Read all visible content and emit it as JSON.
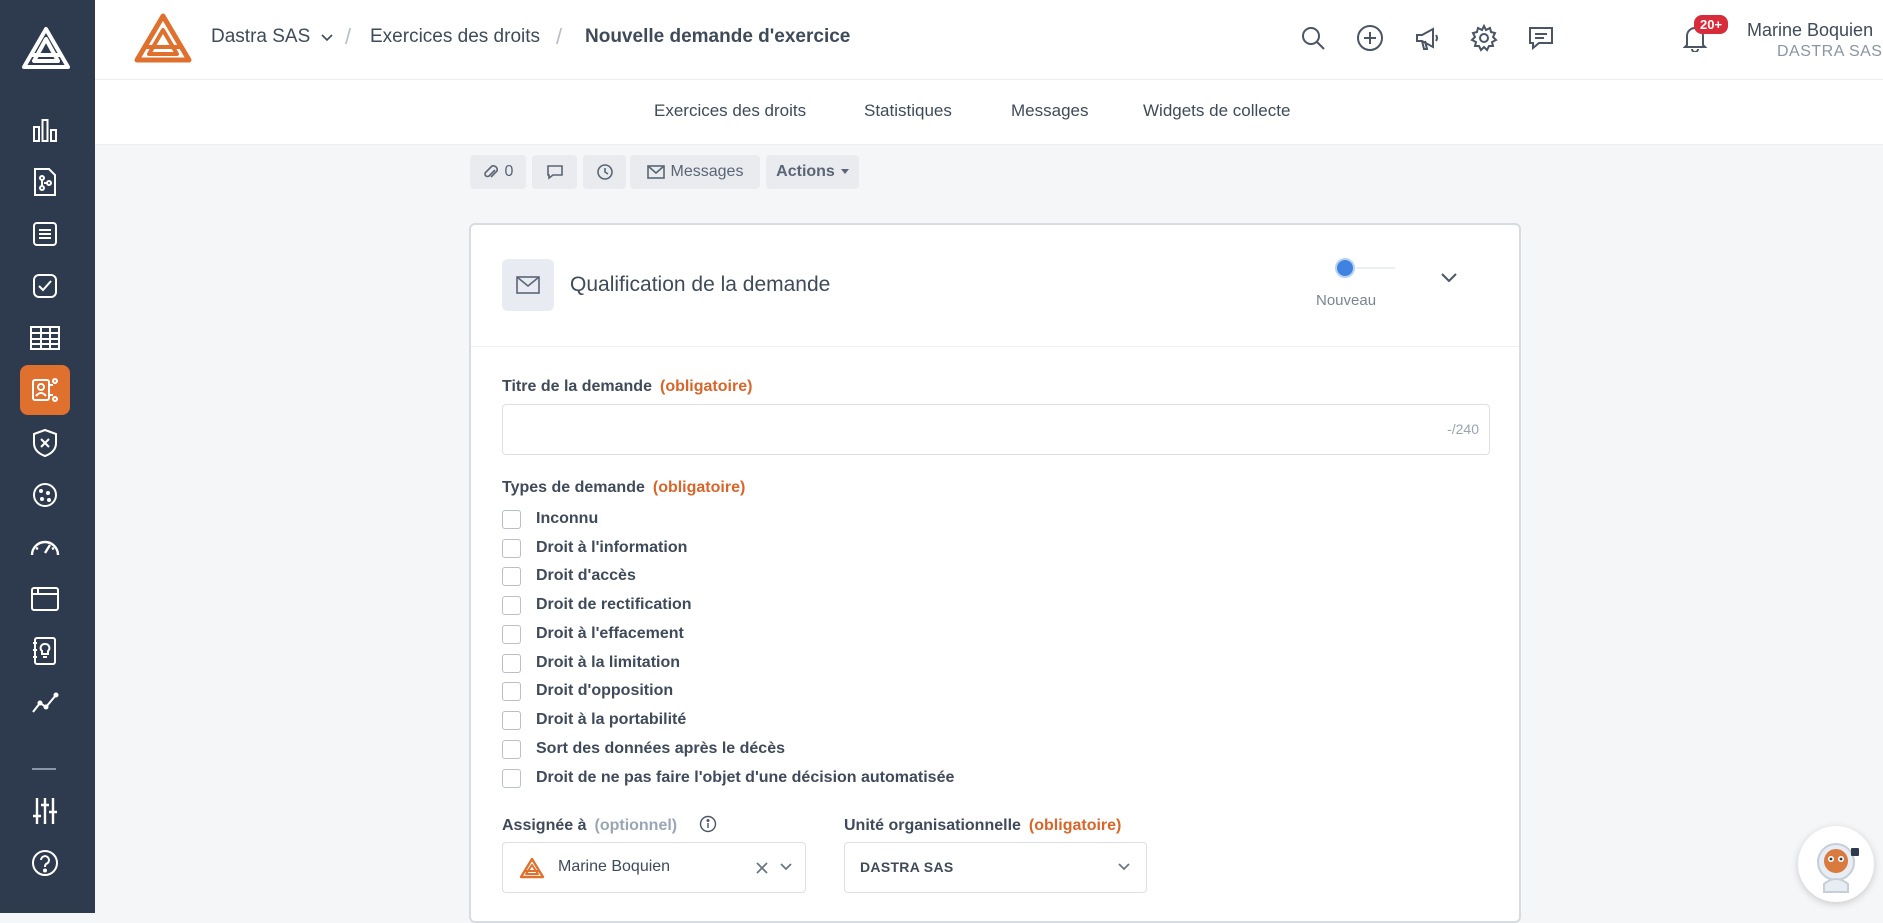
{
  "header": {
    "org_name": "Dastra SAS",
    "breadcrumb_1": "Exercices des droits",
    "breadcrumb_2": "Nouvelle demande d'exercice",
    "notifications_badge": "20+",
    "user_name": "Marine Boquien",
    "user_org": "DASTRA SAS"
  },
  "sidebar": {
    "items": [
      {
        "icon": "bar-chart-icon"
      },
      {
        "icon": "document-tree-icon"
      },
      {
        "icon": "database-icon"
      },
      {
        "icon": "checklist-icon"
      },
      {
        "icon": "table-icon"
      },
      {
        "icon": "user-request-icon",
        "active": true
      },
      {
        "icon": "shield-x-icon"
      },
      {
        "icon": "cookie-icon"
      },
      {
        "icon": "speedometer-icon"
      },
      {
        "icon": "browser-window-icon"
      },
      {
        "icon": "lightbulb-book-icon"
      },
      {
        "icon": "line-chart-icon"
      },
      {
        "icon": "sliders-icon"
      },
      {
        "icon": "help-icon"
      }
    ]
  },
  "subnav": {
    "items": [
      "Exercices des droits",
      "Statistiques",
      "Messages",
      "Widgets de collecte"
    ]
  },
  "toolbar": {
    "attachments_count": "0",
    "messages_label": "Messages",
    "actions_label": "Actions"
  },
  "card": {
    "title": "Qualification de la demande",
    "status": "Nouveau",
    "title_field": {
      "label": "Titre de la demande",
      "required": "(obligatoire)",
      "value": "",
      "counter": "-/240"
    },
    "types": {
      "label": "Types de demande",
      "required": "(obligatoire)",
      "options": [
        "Inconnu",
        "Droit à l'information",
        "Droit d'accès",
        "Droit de rectification",
        "Droit à l'effacement",
        "Droit à la limitation",
        "Droit d'opposition",
        "Droit à la portabilité",
        "Sort des données après le décès",
        "Droit de ne pas faire l'objet d'une décision automatisée"
      ]
    },
    "assignee": {
      "label": "Assignée à",
      "optional": "(optionnel)",
      "value": "Marine Boquien"
    },
    "unit": {
      "label": "Unité organisationnelle",
      "required": "(obligatoire)",
      "value": "DASTRA SAS"
    }
  },
  "colors": {
    "sidebar_bg": "#2e3b4e",
    "accent": "#e0702e",
    "status_blue": "#3f82e0",
    "badge_red": "#d92c3a"
  }
}
